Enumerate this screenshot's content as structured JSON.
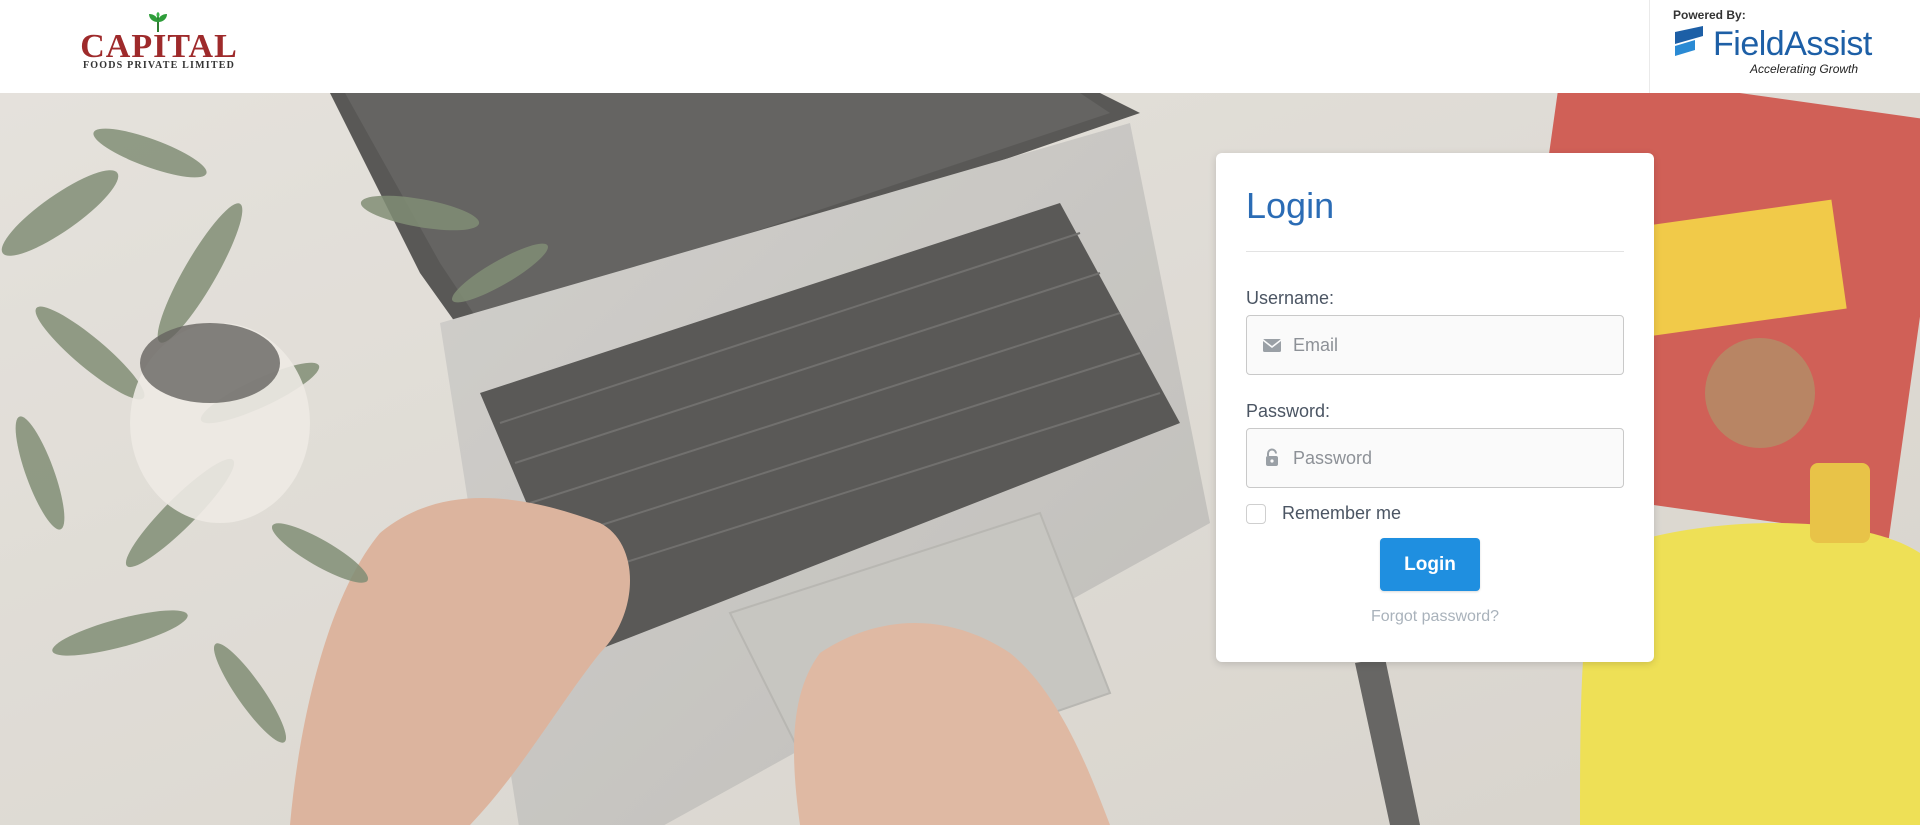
{
  "header": {
    "brand_name": "CAPITAL",
    "brand_sub": "FOODS PRIVATE LIMITED",
    "powered_label": "Powered By:",
    "partner_name": "FieldAssist",
    "partner_tagline": "Accelerating Growth"
  },
  "login": {
    "title": "Login",
    "username_label": "Username:",
    "username_placeholder": "Email",
    "password_label": "Password:",
    "password_placeholder": "Password",
    "remember_label": "Remember me",
    "remember_checked": false,
    "submit_label": "Login",
    "forgot_label": "Forgot password?"
  },
  "icons": {
    "username": "envelope-icon",
    "password": "lock-icon"
  },
  "colors": {
    "primary": "#1f8fe0",
    "title": "#2b6cb5",
    "brand": "#9e2a2b",
    "partner": "#1d5fa6"
  }
}
